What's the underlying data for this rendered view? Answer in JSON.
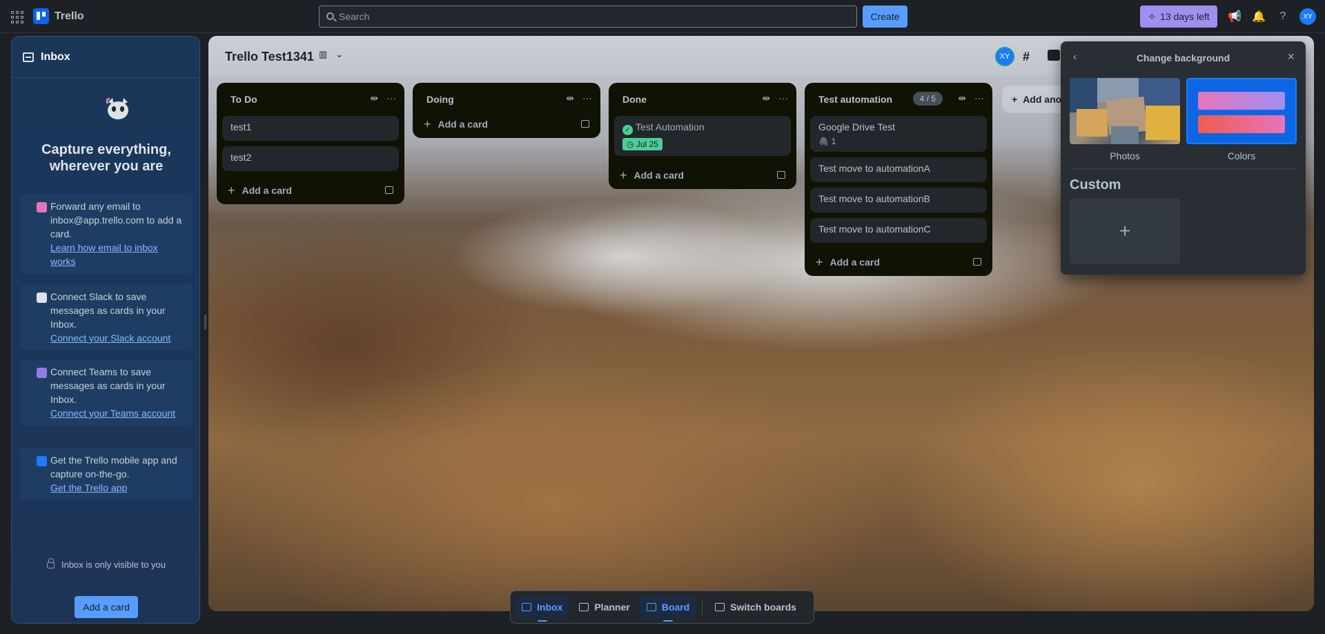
{
  "topbar": {
    "app_name": "Trello",
    "search_placeholder": "Search",
    "create_label": "Create",
    "trial_label": "13 days left",
    "avatar_initials": "XY"
  },
  "inbox": {
    "title": "Inbox",
    "headline": "Capture everything, wherever you are",
    "tips": [
      {
        "text": "Forward any email to inbox@app.trello.com to add a card.",
        "link": "Learn how email to inbox works"
      },
      {
        "text": "Connect Slack to save messages as cards in your Inbox.",
        "link": "Connect your Slack account"
      },
      {
        "text": "Connect Teams to save messages as cards in your Inbox.",
        "link": "Connect your Teams account"
      },
      {
        "text": "Get the Trello mobile app and capture on-the-go.",
        "link": "Get the Trello app"
      }
    ],
    "visibility_note": "Inbox is only visible to you",
    "add_card_label": "Add a card"
  },
  "board": {
    "title": "Trello Test1341",
    "avatar_initials": "XY",
    "add_another_label": "Add another list",
    "lists": [
      {
        "title": "To Do",
        "cards": [
          "test1",
          "test2"
        ],
        "add_label": "Add a card"
      },
      {
        "title": "Doing",
        "cards": [],
        "add_label": "Add a card"
      },
      {
        "title": "Done",
        "cards": [
          "Test Automation"
        ],
        "due": "Jul 25",
        "add_label": "Add a card"
      },
      {
        "title": "Test automation",
        "count": "4 / 5",
        "cards": [
          "Google Drive Test",
          "Test move to automationA",
          "Test move to automationB",
          "Test move to automationC"
        ],
        "attachments": "1",
        "add_label": "Add a card"
      }
    ]
  },
  "popover": {
    "title": "Change background",
    "photos_label": "Photos",
    "colors_label": "Colors",
    "custom_label": "Custom"
  },
  "bottom_nav": {
    "inbox": "Inbox",
    "planner": "Planner",
    "board": "Board",
    "switch": "Switch boards"
  },
  "colors": {
    "accent": "#579dff",
    "trial": "#9f8fef",
    "done_green": "#4bce97"
  }
}
